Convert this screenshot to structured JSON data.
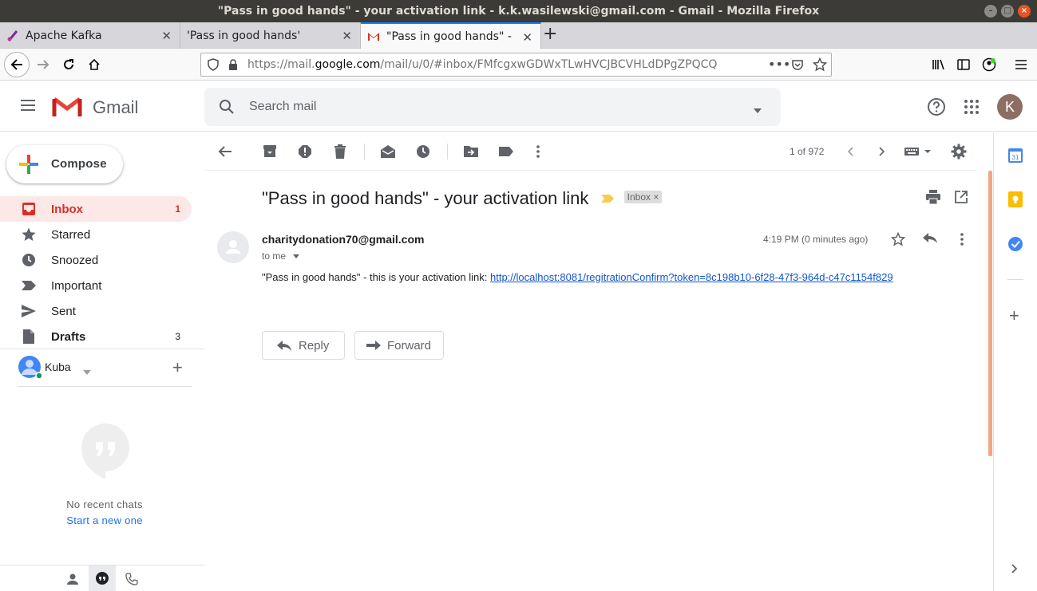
{
  "window": {
    "title": "\"Pass in good hands\" - your activation link - k.k.wasilewski@gmail.com - Gmail - Mozilla Firefox"
  },
  "tabs": [
    {
      "label": "Apache Kafka",
      "icon": "kafka-icon"
    },
    {
      "label": "'Pass in good hands'",
      "icon": "none"
    },
    {
      "label": "\"Pass in good hands\" - yo",
      "icon": "gmail-icon",
      "active": true
    }
  ],
  "urlbar": {
    "prefix": "https://mail.",
    "host": "google.com",
    "path": "/mail/u/0/#inbox/FMfcgxwGDWxTLwHVCJBCVHLdDPgZPQCQ"
  },
  "gmail": {
    "product": "Gmail",
    "search_placeholder": "Search mail",
    "account_initial": "K"
  },
  "sidebar": {
    "compose": "Compose",
    "items": [
      {
        "label": "Inbox",
        "count": "1",
        "icon": "inbox-icon",
        "active": true
      },
      {
        "label": "Starred",
        "count": "",
        "icon": "star-icon"
      },
      {
        "label": "Snoozed",
        "count": "",
        "icon": "clock-icon"
      },
      {
        "label": "Important",
        "count": "",
        "icon": "important-icon"
      },
      {
        "label": "Sent",
        "count": "",
        "icon": "send-icon"
      },
      {
        "label": "Drafts",
        "count": "3",
        "icon": "draft-icon",
        "bold": true
      }
    ],
    "hangouts_user": "Kuba",
    "no_chats": "No recent chats",
    "start_new": "Start a new one"
  },
  "toolbar": {
    "pagination": "1 of 972"
  },
  "message": {
    "subject": "\"Pass in good hands\" - your activation link",
    "label": "Inbox",
    "sender": "charitydonation70@gmail.com",
    "to": "to me",
    "time": "4:19 PM (0 minutes ago)",
    "body_text": "\"Pass in good hands\" - this is your activation link: ",
    "link": "http://localhost:8081/regitrationConfirm?token=8c198b10-6f28-47f3-964d-c47c1154f829"
  },
  "actions": {
    "reply": "Reply",
    "forward": "Forward"
  },
  "colors": {
    "accent_red": "#d93025",
    "active_bg": "#fce8e6",
    "link": "#1155cc"
  }
}
